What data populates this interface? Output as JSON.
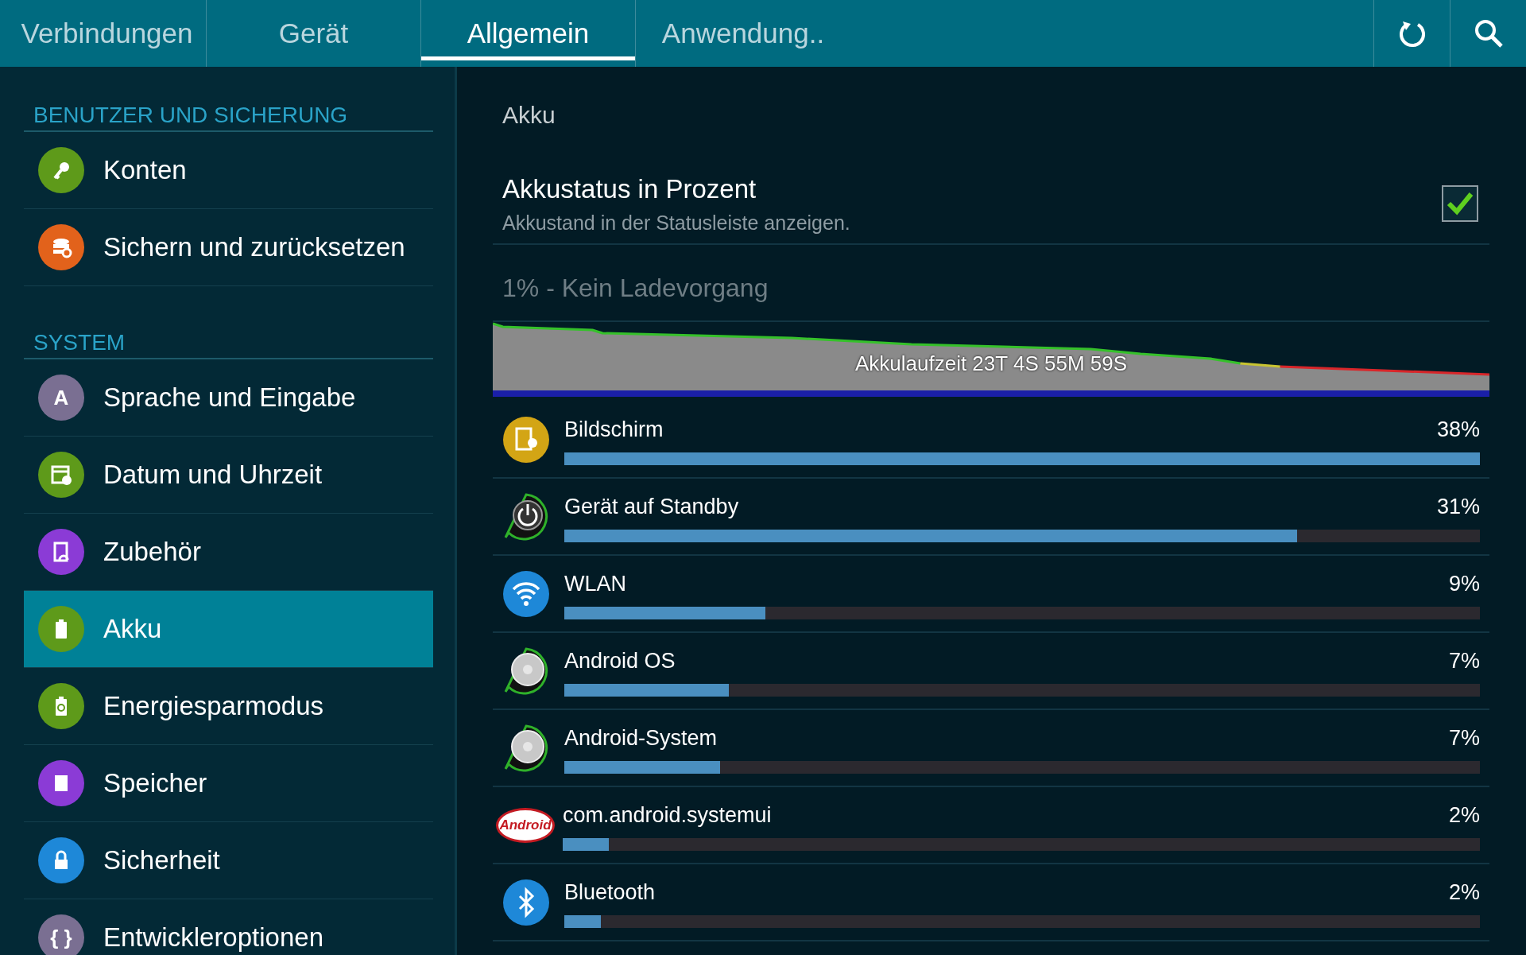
{
  "tabs": [
    {
      "label": "Verbindungen",
      "selected": false
    },
    {
      "label": "Gerät",
      "selected": false
    },
    {
      "label": "Allgemein",
      "selected": true
    },
    {
      "label": "Anwendung..",
      "selected": false
    }
  ],
  "sidebar": {
    "sections": [
      {
        "title": "BENUTZER UND SICHERUNG",
        "items": [
          {
            "label": "Konten",
            "kind": "key",
            "color": "#5e9a1a",
            "selected": false
          },
          {
            "label": "Sichern und zurücksetzen",
            "kind": "backup",
            "color": "#e2621b",
            "selected": false
          }
        ]
      },
      {
        "title": "SYSTEM",
        "items": [
          {
            "label": "Sprache und Eingabe",
            "kind": "letter",
            "icon_text": "A",
            "color": "#7a6f92",
            "selected": false
          },
          {
            "label": "Datum und Uhrzeit",
            "kind": "calendar",
            "color": "#5e9a1a",
            "selected": false
          },
          {
            "label": "Zubehör",
            "kind": "accessory",
            "color": "#8b3bd6",
            "selected": false
          },
          {
            "label": "Akku",
            "kind": "battery",
            "color": "#5e9a1a",
            "selected": true
          },
          {
            "label": "Energiesparmodus",
            "kind": "powersave",
            "color": "#5e9a1a",
            "selected": false
          },
          {
            "label": "Speicher",
            "kind": "storage",
            "color": "#8b3bd6",
            "selected": false
          },
          {
            "label": "Sicherheit",
            "kind": "lock",
            "color": "#1e88d8",
            "selected": false
          },
          {
            "label": "Entwickleroptionen",
            "kind": "letter",
            "icon_text": "{ }",
            "color": "#7a6f92",
            "selected": false
          }
        ]
      }
    ]
  },
  "content": {
    "title": "Akku",
    "setting": {
      "title": "Akkustatus in Prozent",
      "subtitle": "Akkustand in der Statusleiste anzeigen.",
      "checked": true
    },
    "status": "1% - Kein Ladevorgang",
    "graph": {
      "label": "Akkulaufzeit 23T 4S 55M 59S"
    },
    "usage": [
      {
        "name": "Bildschirm",
        "percent": "38%",
        "level": 1.0,
        "kind": "display"
      },
      {
        "name": "Gerät auf Standby",
        "percent": "31%",
        "level": 0.8,
        "kind": "power"
      },
      {
        "name": "WLAN",
        "percent": "9%",
        "level": 0.22,
        "kind": "wifi"
      },
      {
        "name": "Android OS",
        "percent": "7%",
        "level": 0.18,
        "kind": "os"
      },
      {
        "name": "Android-System",
        "percent": "7%",
        "level": 0.17,
        "kind": "os"
      },
      {
        "name": "com.android.systemui",
        "percent": "2%",
        "level": 0.05,
        "kind": "logo",
        "icon_text": "Android"
      },
      {
        "name": "Bluetooth",
        "percent": "2%",
        "level": 0.04,
        "kind": "bluetooth"
      }
    ]
  }
}
